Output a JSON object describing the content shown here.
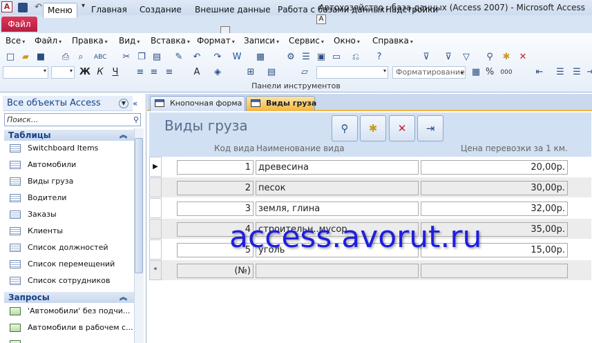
{
  "window": {
    "title": "Автохозяйство : база данных (Access 2007)  -  Microsoft Access"
  },
  "ribbon_tabs": [
    "Файл",
    "Меню",
    "Главная",
    "Создание",
    "Внешние данные",
    "Работа с базами данных",
    "Надстройки"
  ],
  "tooltip_keys": {
    "vnesh": "",
    "rabota": "А"
  },
  "menu": [
    "Все",
    "Файл",
    "Правка",
    "Вид",
    "Вставка",
    "Формат",
    "Записи",
    "Сервис",
    "Окно",
    "Справка"
  ],
  "toolbar": {
    "format_placeholder": "Форматирование",
    "group_label": "Панели инструментов"
  },
  "nav": {
    "title": "Все объекты Access",
    "search_placeholder": "Поиск...",
    "groups": [
      {
        "label": "Таблицы",
        "items": [
          "Switchboard Items",
          "Автомобили",
          "Виды груза",
          "Водители",
          "Заказы",
          "Клиенты",
          "Список должностей",
          "Список перемещений",
          "Список сотрудников"
        ]
      },
      {
        "label": "Запросы",
        "items": [
          "'Автомобили' без подчи...",
          "Автомобили в рабочем с..."
        ]
      }
    ]
  },
  "doc_tabs": [
    "Кнопочная форма",
    "Виды груза"
  ],
  "form": {
    "title": "Виды груза",
    "col_headers": [
      "Код вида",
      "Наименование вида",
      "Цена перевозки за 1 км."
    ],
    "rows": [
      {
        "id": "1",
        "name": "древесина",
        "price": "20,00р."
      },
      {
        "id": "2",
        "name": "песок",
        "price": "30,00р."
      },
      {
        "id": "3",
        "name": "земля, глина",
        "price": "32,00р."
      },
      {
        "id": "4",
        "name": "строительн..мусор",
        "price": "35,00р."
      },
      {
        "id": "5",
        "name": "уголь",
        "price": "15,00р."
      }
    ],
    "new_row": {
      "id": "(№)",
      "name": "",
      "price": ""
    },
    "selectors": [
      "▶",
      "",
      "",
      "",
      "",
      "*"
    ]
  },
  "watermark": "access.avorut.ru",
  "colors": {
    "file_tab": "#c4223f",
    "accent": "#f2b43f",
    "form_header": "#d1e0f2"
  }
}
